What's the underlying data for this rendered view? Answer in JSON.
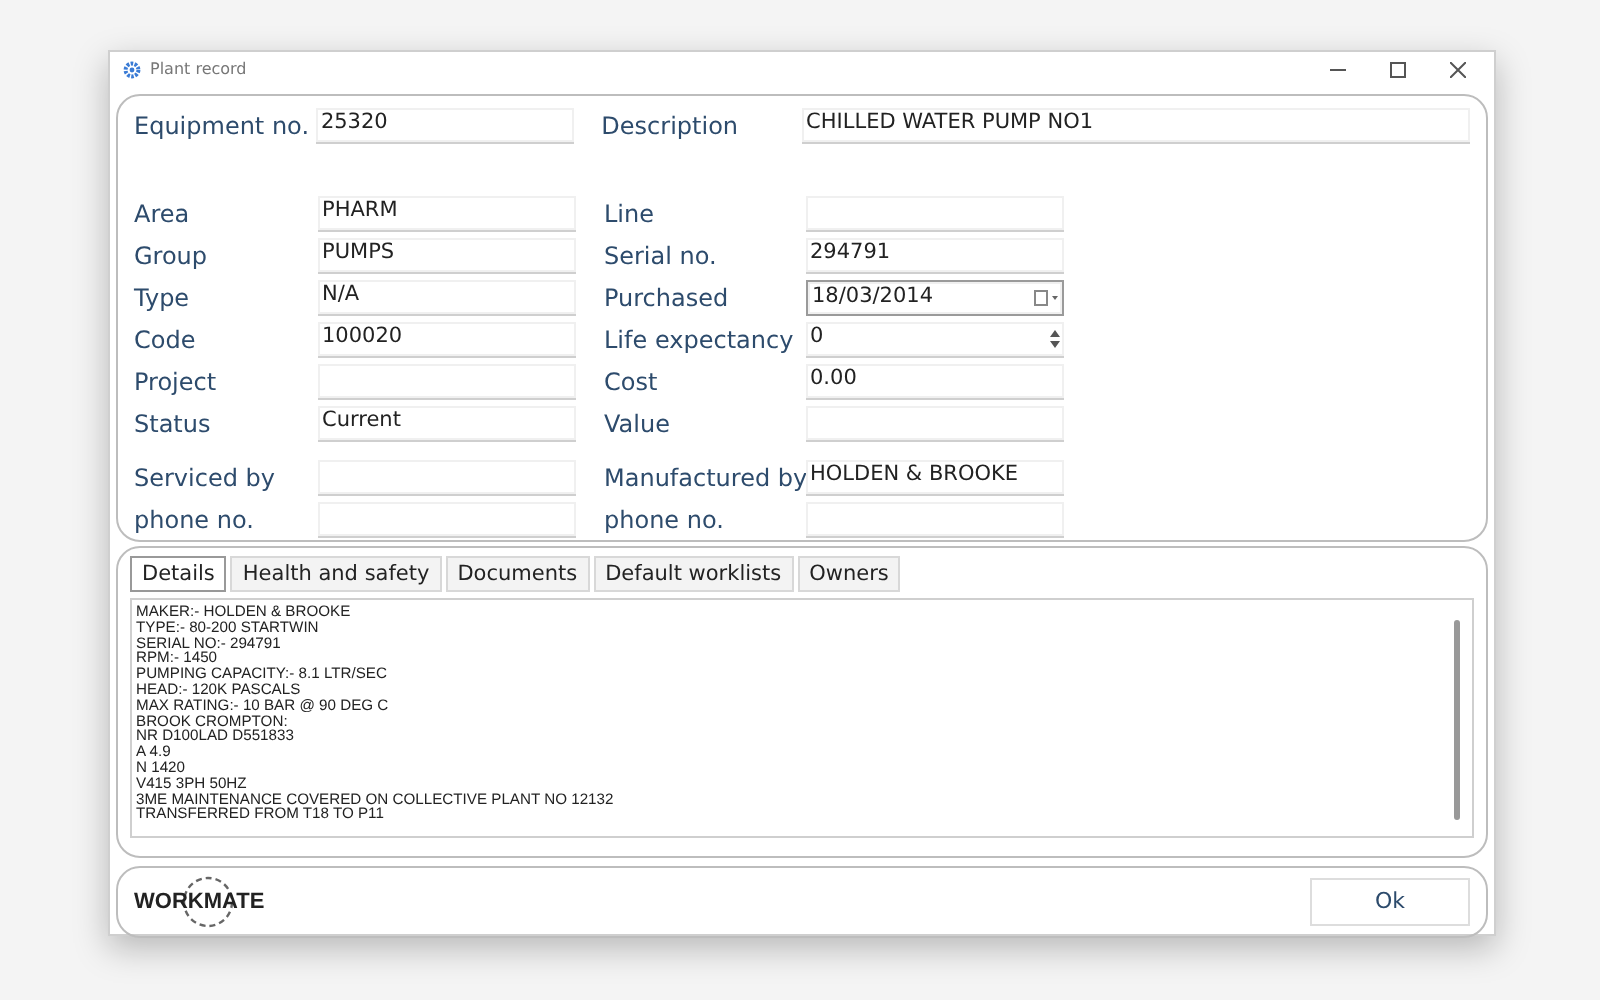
{
  "window": {
    "title": "Plant record"
  },
  "header": {
    "left": {
      "label": "Equipment no.",
      "value": "25320"
    },
    "right": {
      "label": "Description",
      "value": "CHILLED WATER PUMP NO1"
    }
  },
  "field_groups": [
    [
      {
        "left": {
          "label": "Area",
          "value": "PHARM"
        },
        "right": {
          "label": "Line",
          "kind": "text"
        }
      },
      {
        "left": {
          "label": "Group",
          "value": "PUMPS"
        },
        "right": {
          "label": "Serial no.",
          "value": "294791",
          "kind": "text"
        }
      },
      {
        "left": {
          "label": "Type",
          "value": "N/A"
        },
        "right": {
          "label": "Purchased",
          "value": "18/03/2014",
          "kind": "date"
        }
      },
      {
        "left": {
          "label": "Code",
          "value": "100020"
        },
        "right": {
          "label": "Life expectancy",
          "value": "0",
          "kind": "spinner"
        }
      },
      {
        "left": {
          "label": "Project"
        },
        "right": {
          "label": "Cost",
          "value": "0.00",
          "kind": "text"
        }
      },
      {
        "left": {
          "label": "Status",
          "value": "Current"
        },
        "right": {
          "label": "Value",
          "kind": "text"
        }
      }
    ],
    [
      {
        "left": {
          "label": "Serviced by"
        },
        "right": {
          "label": "Manufactured by",
          "value": "HOLDEN & BROOKE",
          "kind": "text"
        }
      },
      {
        "left": {
          "label": "phone no."
        },
        "right": {
          "label": "phone no.",
          "kind": "text"
        }
      }
    ]
  ],
  "tabs": [
    {
      "label": "Details",
      "selected": true
    },
    {
      "label": "Health and safety",
      "selected": false
    },
    {
      "label": "Documents",
      "selected": false
    },
    {
      "label": "Default worklists",
      "selected": false
    },
    {
      "label": "Owners",
      "selected": false
    }
  ],
  "notes": [
    "MAKER:- HOLDEN & BROOKE",
    "TYPE:- 80-200 STARTWIN",
    "SERIAL NO:- 294791",
    "RPM:- 1450",
    "PUMPING CAPACITY:- 8.1 LTR/SEC",
    "HEAD:- 120K PASCALS",
    "MAX RATING:- 10 BAR @ 90 DEG C",
    "BROOK CROMPTON:",
    "NR D100LAD D551833",
    "A 4.9",
    "N 1420",
    "V415 3PH 50HZ",
    "3ME MAINTENANCE COVERED ON COLLECTIVE PLANT NO 12132",
    "TRANSFERRED FROM T18 TO P11"
  ],
  "footer": {
    "logo": "WORKMATE",
    "button": "Ok"
  }
}
